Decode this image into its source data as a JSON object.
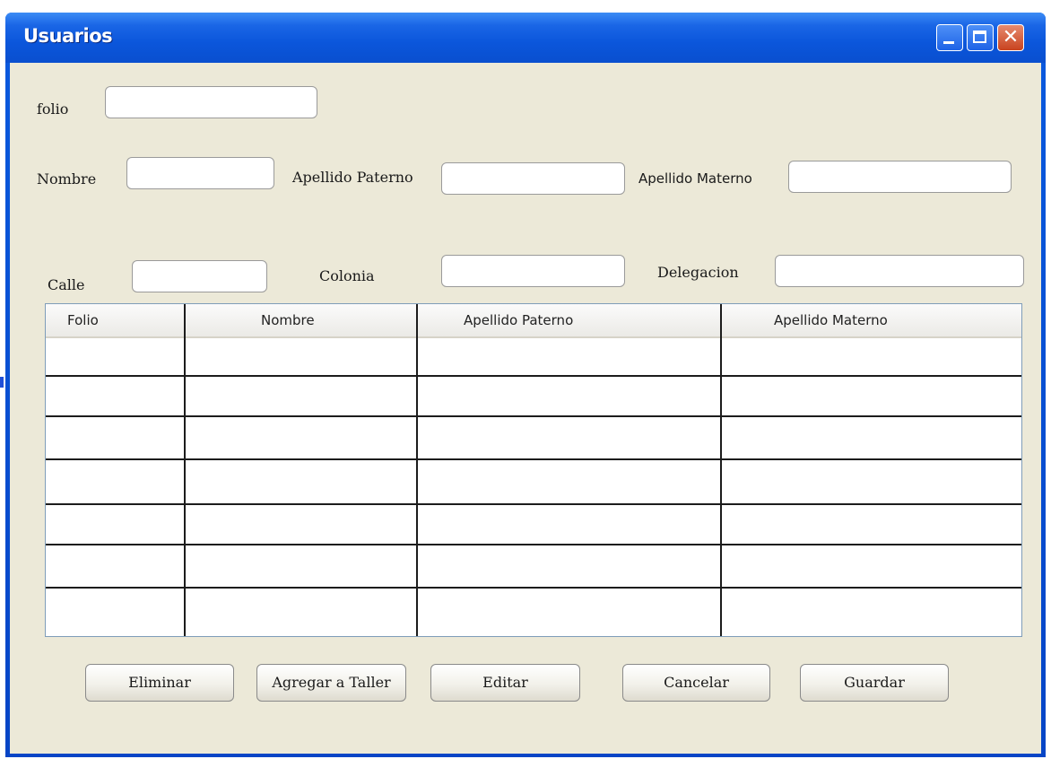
{
  "window": {
    "title": "Usuarios"
  },
  "form": {
    "folio_label": "folio",
    "nombre_label": "Nombre",
    "apellido_paterno_label": "Apellido Paterno",
    "apellido_materno_label": "Apellido Materno",
    "calle_label": "Calle",
    "colonia_label": "Colonia",
    "delegacion_label": "Delegacion",
    "folio_value": "",
    "nombre_value": "",
    "apellido_paterno_value": "",
    "apellido_materno_value": "",
    "calle_value": "",
    "colonia_value": "",
    "delegacion_value": ""
  },
  "table": {
    "columns": [
      "Folio",
      "Nombre",
      "Apellido Paterno",
      "Apellido Materno"
    ],
    "rows": [
      [
        "",
        "",
        "",
        ""
      ],
      [
        "",
        "",
        "",
        ""
      ],
      [
        "",
        "",
        "",
        ""
      ],
      [
        "",
        "",
        "",
        ""
      ],
      [
        "",
        "",
        "",
        ""
      ],
      [
        "",
        "",
        "",
        ""
      ],
      [
        "",
        "",
        "",
        ""
      ]
    ]
  },
  "buttons": {
    "eliminar": "Eliminar",
    "agregar_taller": "Agregar a Taller",
    "editar": "Editar",
    "cancelar": "Cancelar",
    "guardar": "Guardar"
  },
  "colors": {
    "titlebar": "#0a56db",
    "client_background": "#ece9d8",
    "close_button": "#c8431f"
  },
  "icons": {
    "minimize": "minimize-icon",
    "maximize": "maximize-icon",
    "close": "close-icon"
  }
}
